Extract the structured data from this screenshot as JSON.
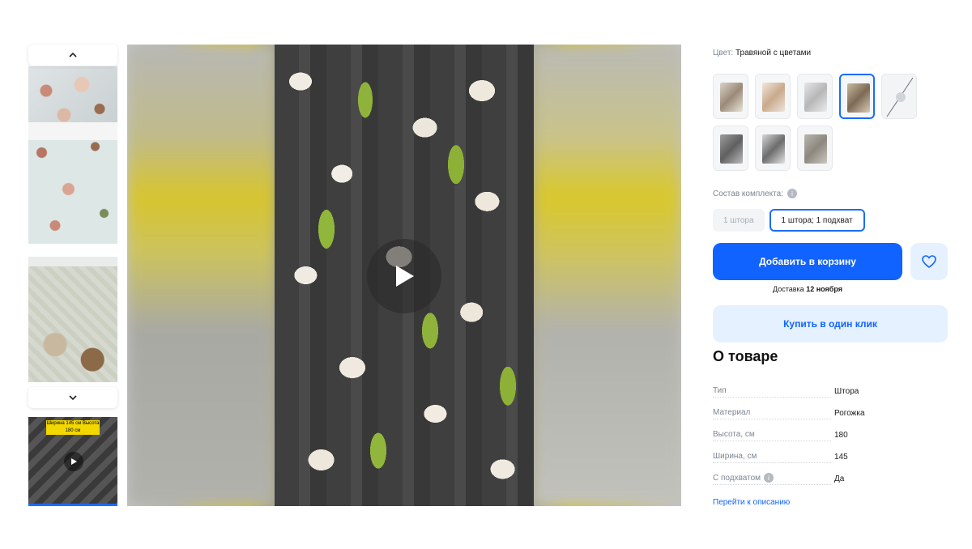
{
  "gallery": {
    "thumb_up_icon": "chevron-up-icon",
    "thumb_down_icon": "chevron-down-icon",
    "video_thumb_tag": "Ширина 145 см\nВысота 180 см",
    "play_icon": "play-icon"
  },
  "product": {
    "color_label": "Цвет:",
    "color_value": "Травяной с цветами",
    "kit_label": "Состав комплекта:",
    "kit_options": [
      "1 штора",
      "1 штора; 1 подхват"
    ],
    "add_to_cart": "Добавить в корзину",
    "delivery_prefix": "Доставка",
    "delivery_date": "12 ноября",
    "buy_one_click": "Купить в один клик",
    "about_title": "О товаре",
    "specs": [
      {
        "key": "Тип",
        "value": "Штора"
      },
      {
        "key": "Материал",
        "value": "Рогожка"
      },
      {
        "key": "Высота, см",
        "value": "180"
      },
      {
        "key": "Ширина, см",
        "value": "145"
      },
      {
        "key": "С подхватом",
        "value": "Да"
      }
    ],
    "go_to_description": "Перейти к описанию"
  },
  "colors": {
    "accent": "#1163ff",
    "accent_light": "#e5f1ff",
    "muted_text": "#7d8591"
  }
}
